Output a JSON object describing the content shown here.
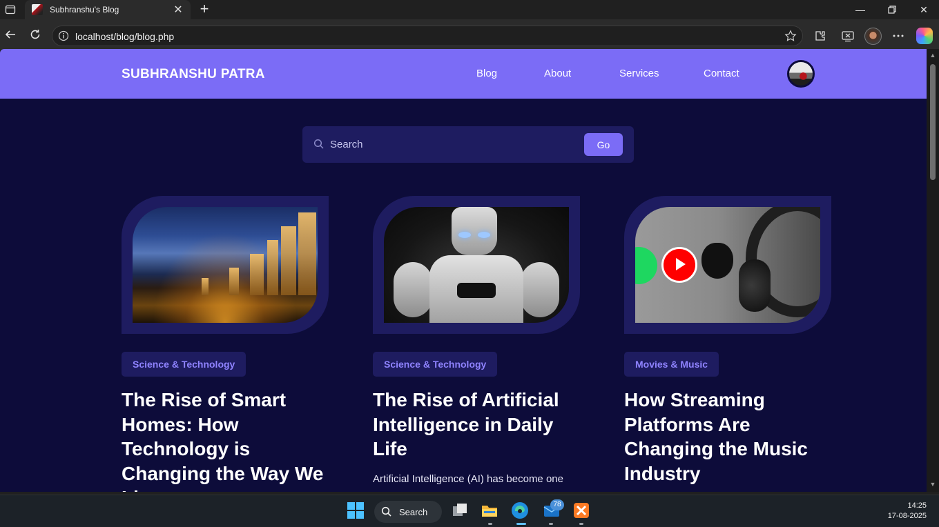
{
  "browser": {
    "tab_title": "Subhranshu's Blog",
    "url": "localhost/blog/blog.php"
  },
  "site": {
    "brand": "SUBHRANSHU PATRA",
    "nav": [
      {
        "label": "Blog"
      },
      {
        "label": "About"
      },
      {
        "label": "Services"
      },
      {
        "label": "Contact"
      }
    ]
  },
  "search": {
    "placeholder": "Search",
    "button": "Go"
  },
  "posts": [
    {
      "category": "Science & Technology",
      "title": "The Rise of Smart Homes: How Technology is Changing the Way We Live",
      "image": "city-night-skyline"
    },
    {
      "category": "Science & Technology",
      "title": "The Rise of Artificial Intelligence in Daily Life",
      "excerpt": "Artificial Intelligence (AI) has become one",
      "image": "humanoid-robot"
    },
    {
      "category": "Movies & Music",
      "title": "How Streaming Platforms Are Changing the Music Industry",
      "image": "headphones-streaming-logos"
    }
  ],
  "taskbar": {
    "search_label": "Search",
    "badge_count": "78",
    "time": "14:25",
    "date": "17-08-2025"
  },
  "colors": {
    "header": "#7b6cf6",
    "page_bg": "#0d0c3a",
    "card_bg": "#1e1c60",
    "category_text": "#8f83ff"
  }
}
